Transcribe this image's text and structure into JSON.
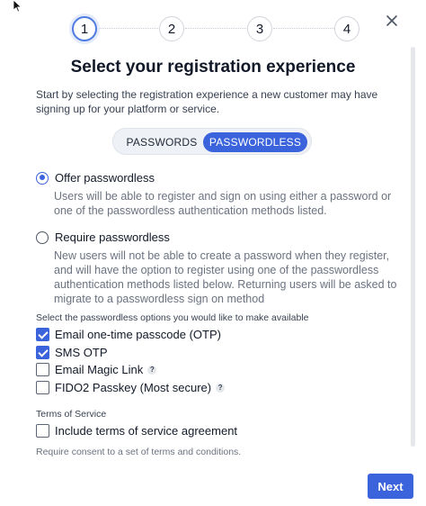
{
  "stepper": {
    "steps": [
      "1",
      "2",
      "3",
      "4"
    ],
    "active_step": 1
  },
  "dialog": {
    "title": "Select your registration experience",
    "intro": "Start by selecting the registration experience a new customer may have signing up for your platform or service."
  },
  "mode_toggle": {
    "options": [
      "PASSWORDS",
      "PASSWORDLESS"
    ],
    "selected": "PASSWORDLESS"
  },
  "radio_options": [
    {
      "label": "Offer passwordless",
      "checked": true,
      "description": "Users will be able to register and sign on using either a password or one of the passwordless authentication methods listed."
    },
    {
      "label": "Require passwordless",
      "checked": false,
      "description": "New users will not be able to create a password when they register, and will have the option to register using one of the passwordless authentication methods listed below. Returning users will be asked to migrate to a passwordless sign on method"
    }
  ],
  "passwordless_options": {
    "heading": "Select the passwordless options you would like to make available",
    "items": [
      {
        "label": "Email one-time passcode (OTP)",
        "checked": true,
        "help": false
      },
      {
        "label": "SMS OTP",
        "checked": true,
        "help": false
      },
      {
        "label": "Email Magic Link",
        "checked": false,
        "help": true
      },
      {
        "label": "FIDO2 Passkey (Most secure)",
        "checked": false,
        "help": true
      }
    ]
  },
  "terms": {
    "heading": "Terms of Service",
    "checkbox_label": "Include terms of service agreement",
    "checked": false,
    "note": "Require consent to a set of terms and conditions."
  },
  "footer": {
    "next_label": "Next"
  },
  "colors": {
    "accent": "#3b63dc",
    "muted_text": "#6b7280"
  },
  "icons": {
    "close": "close-icon",
    "cursor": "mouse-cursor-icon",
    "help": "help-icon"
  }
}
